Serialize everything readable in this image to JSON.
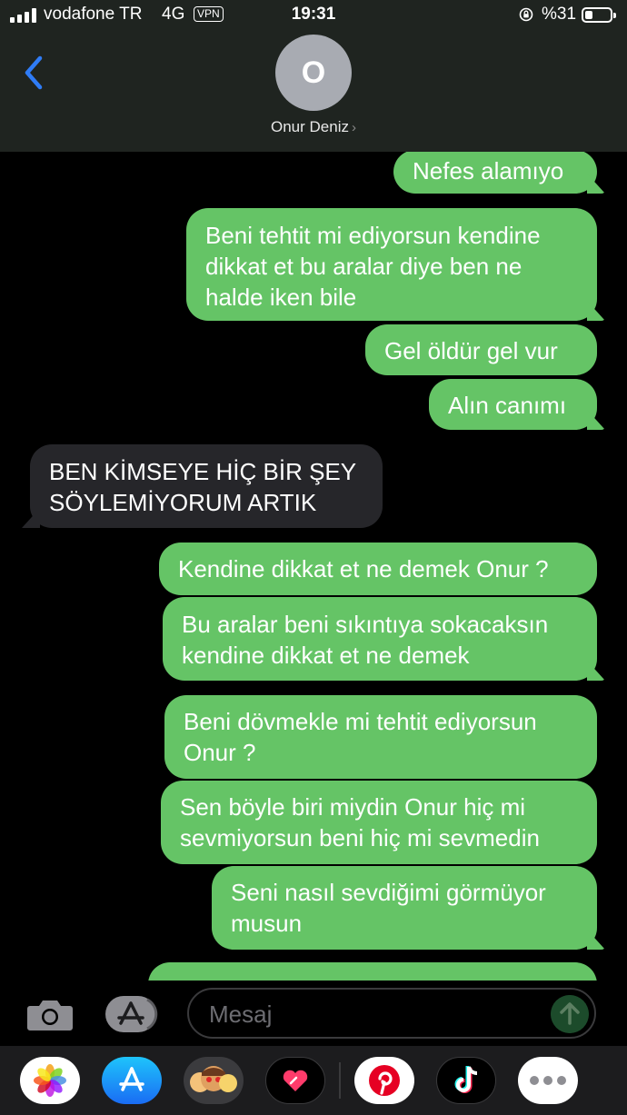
{
  "status_bar": {
    "carrier": "vodafone TR",
    "network": "4G",
    "vpn": "VPN",
    "time": "19:31",
    "battery_percent": "%31",
    "battery_level": 0.31
  },
  "header": {
    "avatar_initial": "O",
    "contact_name": "Onur Deniz",
    "chevron": "›"
  },
  "messages": [
    {
      "from": "me",
      "text": "Nefes alamıyo"
    },
    {
      "from": "me",
      "text": "Beni tehtit mi ediyorsun kendine dikkat et bu aralar diye ben ne halde iken bile"
    },
    {
      "from": "me",
      "text": "Gel öldür gel vur"
    },
    {
      "from": "me",
      "text": "Alın canımı"
    },
    {
      "from": "them",
      "text": "BEN KİMSEYE HİÇ BİR ŞEY SÖYLEMİYORUM ARTIK"
    },
    {
      "from": "me",
      "text": "Kendine dikkat et ne demek Onur ?"
    },
    {
      "from": "me",
      "text": "Bu aralar beni sıkıntıya sokacaksın kendine dikkat et ne demek"
    },
    {
      "from": "me",
      "text": "Beni dövmekle mi tehtit ediyorsun Onur ?"
    },
    {
      "from": "me",
      "text": "Sen böyle biri miydin Onur hiç mi sevmiyorsun beni hiç mi sevmedin"
    },
    {
      "from": "me",
      "text": "Seni nasıl sevdiğimi görmüyor musun"
    }
  ],
  "input": {
    "placeholder": "Mesaj"
  },
  "app_drawer": [
    {
      "icon": "photos-app-icon"
    },
    {
      "icon": "app-store-icon"
    },
    {
      "icon": "memoji-stickers-icon"
    },
    {
      "icon": "digital-touch-icon"
    },
    {
      "icon": "pinterest-icon"
    },
    {
      "icon": "tiktok-icon"
    },
    {
      "icon": "more-apps-icon"
    }
  ],
  "colors": {
    "sent_bubble": "#65c466",
    "received_bubble": "#26262a",
    "header_bg": "#1f2420",
    "accent_blue": "#2f7cf6"
  }
}
